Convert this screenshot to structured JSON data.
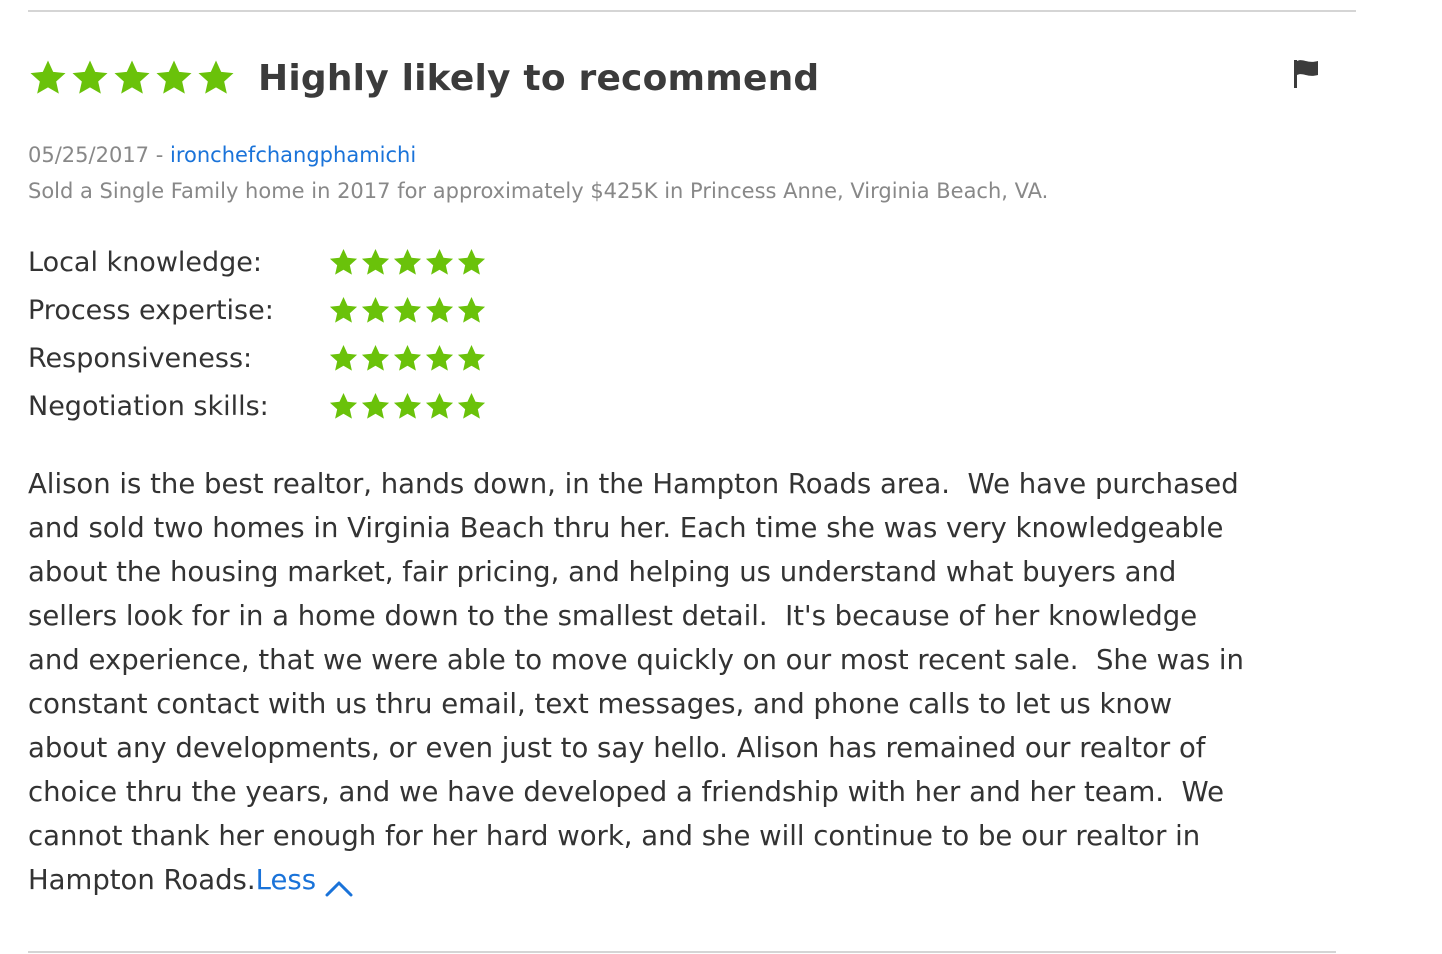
{
  "review": {
    "overall_rating": 5,
    "rating_max": 5,
    "headline": "Highly likely to recommend",
    "date": "05/25/2017",
    "separator": " - ",
    "author": "ironchefchangphamichi",
    "transaction": "Sold a Single Family home in 2017 for approximately $425K in Princess Anne, Virginia Beach, VA.",
    "sub_ratings": [
      {
        "label": "Local knowledge:",
        "rating": 5
      },
      {
        "label": "Process expertise:",
        "rating": 5
      },
      {
        "label": "Responsiveness:",
        "rating": 5
      },
      {
        "label": "Negotiation skills:",
        "rating": 5
      }
    ],
    "body_lines": [
      "Alison is the best realtor, hands down, in the Hampton Roads area.  We have purchased",
      "and sold two homes in Virginia Beach thru her. Each time she was very knowledgeable",
      "about the housing market, fair pricing, and helping us understand what buyers and",
      "sellers look for in a home down to the smallest detail.  It's because of her knowledge",
      "and experience, that we were able to move quickly on our most recent sale.  She was in",
      "constant contact with us thru email, text messages, and phone calls to let us know",
      "about any developments, or even just to say hello. Alison has remained our realtor of",
      "choice thru the years, and we have developed a friendship with her and her team.  We",
      "cannot thank her enough for her hard work, and she will continue to be our realtor in",
      "Hampton Roads."
    ],
    "less_label": "Less",
    "flag_icon": "flag-icon"
  },
  "colors": {
    "star": "#6ac20a",
    "link": "#1a73d9",
    "muted": "#888888",
    "text": "#333333",
    "divider": "#d5d5d5"
  }
}
